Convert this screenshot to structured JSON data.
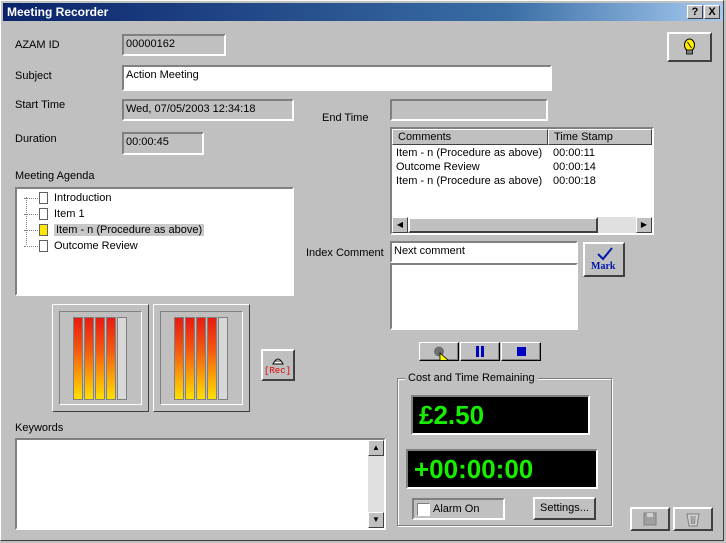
{
  "window": {
    "title": "Meeting Recorder",
    "help_label": "?",
    "close_label": "X"
  },
  "fields": {
    "azam_id": {
      "label": "AZAM ID",
      "value": "00000162"
    },
    "subject": {
      "label": "Subject",
      "value": "Action Meeting"
    },
    "start_time": {
      "label": "Start Time",
      "value": "Wed, 07/05/2003 12:34:18"
    },
    "end_time": {
      "label": "End Time",
      "value": ""
    },
    "duration": {
      "label": "Duration",
      "value": "00:00:45"
    }
  },
  "agenda": {
    "label": "Meeting Agenda",
    "items": [
      {
        "label": "Introduction",
        "selected": false
      },
      {
        "label": "Item 1",
        "selected": false
      },
      {
        "label": "Item - n (Procedure as above)",
        "selected": true
      },
      {
        "label": "Outcome Review",
        "selected": false
      }
    ]
  },
  "meters": {
    "left_level": 0.8,
    "right_level": 0.8,
    "rec_label": "[Rec]"
  },
  "comments_list": {
    "columns": [
      "Comments",
      "Time Stamp"
    ],
    "rows": [
      {
        "comment": "Item - n (Procedure as above)",
        "time": "00:00:11"
      },
      {
        "comment": "Outcome Review",
        "time": "00:00:14"
      },
      {
        "comment": "Item - n (Procedure as above)",
        "time": "00:00:18"
      }
    ]
  },
  "index_comment": {
    "label": "Index Comment",
    "value": "Next comment",
    "notes": "",
    "mark_label": "Mark"
  },
  "transport": {
    "record_icon": "record-icon",
    "pause_icon": "pause-icon",
    "stop_icon": "stop-icon",
    "stop_color": "#0000c0"
  },
  "cost": {
    "group_label": "Cost and Time Remaining",
    "amount": "£2.50",
    "time": "+00:00:00",
    "lcd_color": "#16f000",
    "alarm_label": "Alarm On",
    "alarm_checked": false,
    "settings_label": "Settings..."
  },
  "keywords": {
    "label": "Keywords",
    "value": ""
  }
}
